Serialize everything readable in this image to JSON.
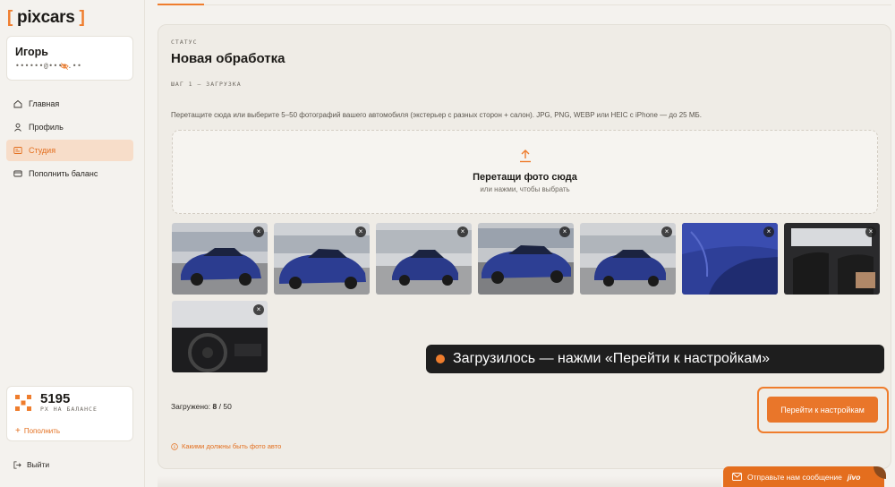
{
  "app": {
    "logo_left": "[",
    "logo_text": "pixcars",
    "logo_right": "]"
  },
  "user": {
    "name": "Игорь",
    "phone_masked": "••••••@••••.••"
  },
  "nav": {
    "items": [
      {
        "label": "Главная",
        "icon": "home-icon"
      },
      {
        "label": "Профиль",
        "icon": "user-icon"
      },
      {
        "label": "Студия",
        "icon": "studio-icon",
        "active": true
      },
      {
        "label": "Пополнить баланс",
        "icon": "card-icon"
      }
    ]
  },
  "balance": {
    "amount": "5195",
    "caption": "РХ НА БАЛАНСЕ",
    "topup_label": "Пополнить"
  },
  "logout_label": "Выйти",
  "main": {
    "status_caption": "СТАТУС",
    "title": "Новая обработка",
    "step_caption": "ШАГ 1 — ЗАГРУЗКА",
    "hint": "Перетащите сюда или выберите 5–50 фотографий вашего автомобиля (экстерьер с разных сторон + салон). JPG, PNG, WEBP или HEIC с iPhone — до 25 МБ.",
    "dropzone_title": "Перетащи фото сюда",
    "dropzone_sub": "или нажми, чтобы выбрать",
    "remove_symbol": "×",
    "loaded_label": "Загружено:",
    "loaded_count": "8",
    "loaded_sep": " / ",
    "loaded_max": "50",
    "next_button": "Перейти к настройкам",
    "faq_link": "Какими должны быть фото авто"
  },
  "toast": {
    "text": "Загрузилось — нажми «Перейти к настройкам»"
  },
  "chat": {
    "label": "Отправьте нам сообщение",
    "brand": "jivo"
  },
  "colors": {
    "accent": "#ef7d2d",
    "car_blue": "#2b3c8f",
    "toast_bg": "#1e1e1e"
  }
}
